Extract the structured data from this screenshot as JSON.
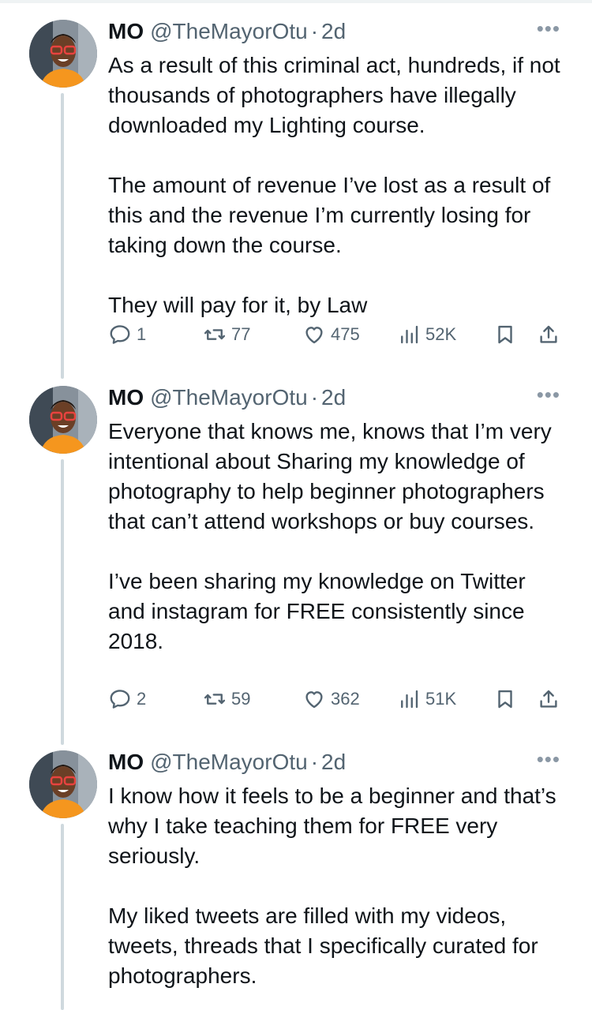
{
  "tweets": [
    {
      "name": "MO",
      "handle": "@TheMayorOtu",
      "separator": "·",
      "time": "2d",
      "more": "•••",
      "paragraphs": [
        "As a result of this criminal act, hundreds, if not thousands of photographers have illegally downloaded my Lighting course.",
        "The amount of revenue I’ve lost as a result of this and the revenue I’m currently losing for taking down the course.",
        "They will pay for it, by Law"
      ],
      "replies": "1",
      "retweets": "77",
      "likes": "475",
      "views": "52K"
    },
    {
      "name": "MO",
      "handle": "@TheMayorOtu",
      "separator": "·",
      "time": "2d",
      "more": "•••",
      "paragraphs": [
        "Everyone that knows me, knows that I’m very intentional about Sharing my knowledge of photography to help beginner photographers that can’t attend workshops or buy courses.",
        "I’ve been sharing my knowledge on Twitter and instagram for FREE consistently since 2018."
      ],
      "replies": "2",
      "retweets": "59",
      "likes": "362",
      "views": "51K"
    },
    {
      "name": "MO",
      "handle": "@TheMayorOtu",
      "separator": "·",
      "time": "2d",
      "more": "•••",
      "paragraphs": [
        "I know how it feels to be a beginner and that’s why I take teaching them for FREE very seriously.",
        "My liked tweets are filled with my videos, tweets, threads that I specifically curated for photographers."
      ]
    }
  ],
  "icons": {
    "reply": "reply-icon",
    "retweet": "retweet-icon",
    "like": "heart-icon",
    "views": "views-icon",
    "bookmark": "bookmark-icon",
    "share": "share-icon"
  },
  "colors": {
    "text": "#0f1419",
    "secondary": "#536471",
    "thread_line": "#cfd9de",
    "avatar_shirt": "#f5961e",
    "avatar_glasses": "#e8433f"
  }
}
